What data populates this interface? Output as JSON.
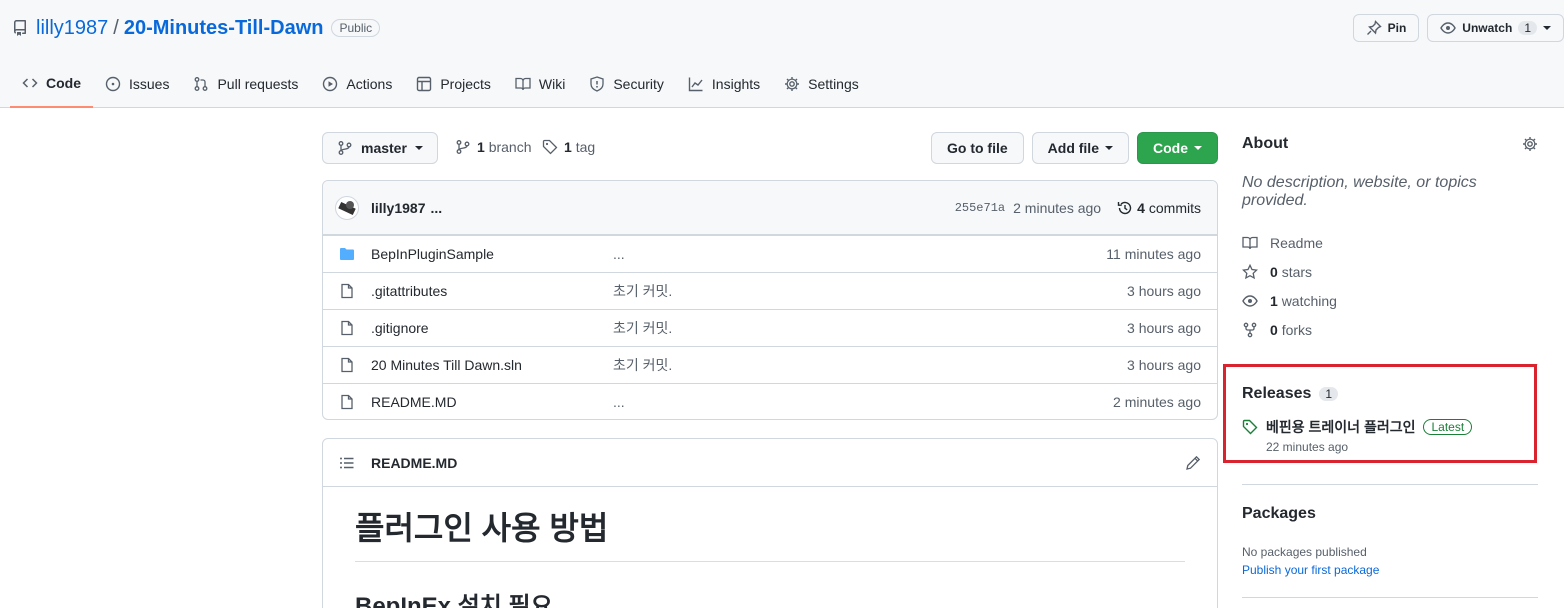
{
  "repo": {
    "owner": "lilly1987",
    "separator": "/",
    "name": "20-Minutes-Till-Dawn",
    "visibility": "Public"
  },
  "header_actions": {
    "pin": "Pin",
    "unwatch": "Unwatch",
    "watch_count": "1"
  },
  "nav": [
    {
      "label": "Code",
      "icon": "code-icon",
      "selected": true
    },
    {
      "label": "Issues",
      "icon": "issue-icon"
    },
    {
      "label": "Pull requests",
      "icon": "pull-request-icon"
    },
    {
      "label": "Actions",
      "icon": "play-icon"
    },
    {
      "label": "Projects",
      "icon": "table-icon"
    },
    {
      "label": "Wiki",
      "icon": "book-icon"
    },
    {
      "label": "Security",
      "icon": "shield-icon"
    },
    {
      "label": "Insights",
      "icon": "graph-icon"
    },
    {
      "label": "Settings",
      "icon": "gear-icon"
    }
  ],
  "branch": {
    "name": "master",
    "branches_count": "1",
    "branches_label": "branch",
    "tags_count": "1",
    "tags_label": "tag"
  },
  "buttons": {
    "go_to_file": "Go to file",
    "add_file": "Add file",
    "code": "Code"
  },
  "latest_commit": {
    "author": "lilly1987",
    "message": "...",
    "sha": "255e71a",
    "age": "2 minutes ago",
    "commits_count": "4",
    "commits_label": "commits"
  },
  "files": [
    {
      "name": "BepInPluginSample",
      "type": "folder",
      "message": "...",
      "age": "11 minutes ago"
    },
    {
      "name": ".gitattributes",
      "type": "file",
      "message": "초기 커밋.",
      "age": "3 hours ago"
    },
    {
      "name": ".gitignore",
      "type": "file",
      "message": "초기 커밋.",
      "age": "3 hours ago"
    },
    {
      "name": "20 Minutes Till Dawn.sln",
      "type": "file",
      "message": "초기 커밋.",
      "age": "3 hours ago"
    },
    {
      "name": "README.MD",
      "type": "file",
      "message": "...",
      "age": "2 minutes ago"
    }
  ],
  "readme": {
    "filename": "README.MD",
    "h1": "플러그인 사용 방법",
    "h2": "BepInEx 설치 필요"
  },
  "about": {
    "title": "About",
    "description": "No description, website, or topics provided.",
    "readme": "Readme",
    "stars_count": "0",
    "stars_label": "stars",
    "watching_count": "1",
    "watching_label": "watching",
    "forks_count": "0",
    "forks_label": "forks"
  },
  "releases": {
    "title": "Releases",
    "count": "1",
    "name": "베핀용 트레이너 플러그인",
    "badge": "Latest",
    "age": "22 minutes ago"
  },
  "packages": {
    "title": "Packages",
    "none": "No packages published",
    "link": "Publish your first package"
  },
  "colors": {
    "accent": "#0969da",
    "primary_button": "#2da44e",
    "highlight": "#d9232e",
    "selected_tab": "#fd8c73"
  }
}
